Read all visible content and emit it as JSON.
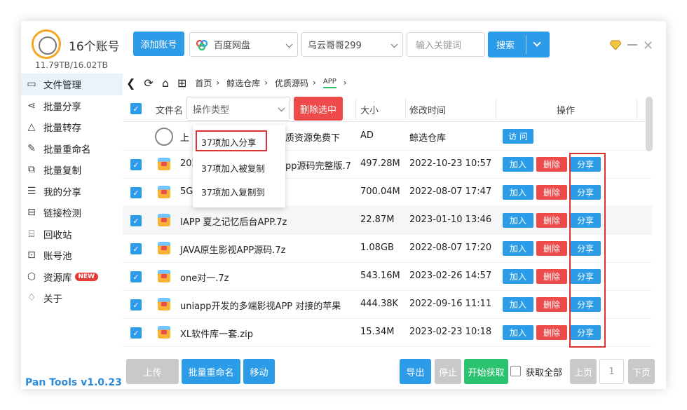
{
  "header": {
    "account_count": "16个账号",
    "storage": "11.79TB/16.02TB",
    "add_account": "添加账号",
    "disk_select": "百度网盘",
    "user_select": "乌云哥哥299",
    "keyword_placeholder": "输入关键词",
    "search": "搜索"
  },
  "sidebar": {
    "items": [
      {
        "label": "文件管理",
        "icon": "folder-icon",
        "glyph": "▭"
      },
      {
        "label": "批量分享",
        "icon": "share-icon",
        "glyph": "⋖"
      },
      {
        "label": "批量转存",
        "icon": "transfer-icon",
        "glyph": "△"
      },
      {
        "label": "批量重命名",
        "icon": "rename-icon",
        "glyph": "✎"
      },
      {
        "label": "批量复制",
        "icon": "copy-icon",
        "glyph": "⧉"
      },
      {
        "label": "我的分享",
        "icon": "my-share-icon",
        "glyph": "☰"
      },
      {
        "label": "链接检测",
        "icon": "link-check-icon",
        "glyph": "⊟"
      },
      {
        "label": "回收站",
        "icon": "trash-icon",
        "glyph": "⌸"
      },
      {
        "label": "账号池",
        "icon": "account-pool-icon",
        "glyph": "⊡"
      },
      {
        "label": "资源库",
        "icon": "resource-icon",
        "glyph": "⬡"
      },
      {
        "label": "关于",
        "icon": "bell-icon",
        "glyph": "♢"
      }
    ],
    "new_badge": "NEW",
    "version": "Pan Tools v1.0.23"
  },
  "breadcrumb": [
    "首页",
    "鲸选仓库",
    "优质源码",
    "APP"
  ],
  "table": {
    "col_name": "文件名",
    "op_type": "操作类型",
    "delete_selected": "删除选中",
    "col_size": "大小",
    "col_modified": "修改时间",
    "col_actions": "操作",
    "up_row": {
      "name": "上",
      "name_tail": "质资源免费下",
      "size": "AD",
      "date": "鲸选仓库",
      "action": "访 问"
    },
    "rows": [
      {
        "name": "202",
        "name_tail": "pp源码完整版.7",
        "size": "497.28M",
        "date": "2022-10-23 10:57"
      },
      {
        "name": "5G",
        "name_tail": "",
        "size": "700.04M",
        "date": "2022-08-07 17:47"
      },
      {
        "name": "IAPP 夏之记忆后台APP.7z",
        "name_tail": "",
        "size": "22.87M",
        "date": "2023-01-10 13:46"
      },
      {
        "name": "JAVA原生影视APP源码.7z",
        "name_tail": "",
        "size": "1.08GB",
        "date": "2022-08-07 17:20"
      },
      {
        "name": "one对一.7z",
        "name_tail": "",
        "size": "543.16M",
        "date": "2023-02-26 14:57"
      },
      {
        "name": "uniapp开发的多端影视APP 对接的苹果",
        "name_tail": "",
        "size": "444.38K",
        "date": "2022-09-16 11:11"
      },
      {
        "name": "XL软件库一套.zip",
        "name_tail": "",
        "size": "15.34M",
        "date": "2023-02-23 10:18"
      }
    ],
    "btn_add": "加入",
    "btn_delete": "删除",
    "btn_share": "分享"
  },
  "menu": {
    "items": [
      "37项加入分享",
      "37项加入被复制",
      "37项加入复制到"
    ]
  },
  "footer": {
    "upload": "上传",
    "batch_rename": "批量重命名",
    "move": "移动",
    "export": "导出",
    "stop": "停止",
    "start_fetch": "开始获取",
    "fetch_all": "获取全部",
    "prev": "上页",
    "page": "1",
    "next": "下页"
  },
  "colors": {
    "accent": "#2c9be8",
    "danger": "#ee4a4a",
    "success": "#2bc270"
  }
}
